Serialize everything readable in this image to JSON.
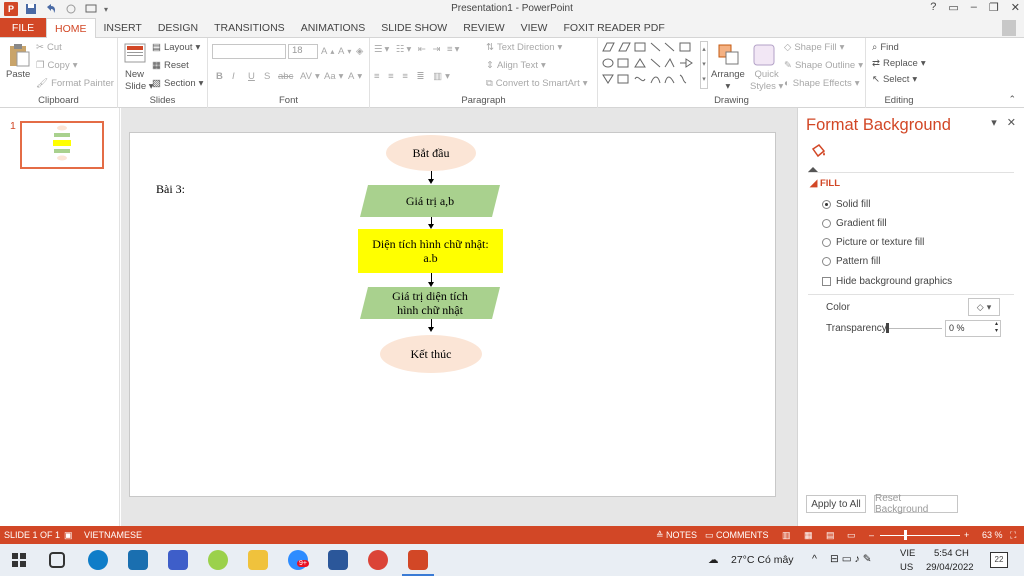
{
  "window": {
    "title": "Presentation1 - PowerPoint",
    "controls": [
      "?",
      "▭",
      "–",
      "❐",
      "✕"
    ]
  },
  "tabs": [
    "FILE",
    "HOME",
    "INSERT",
    "DESIGN",
    "TRANSITIONS",
    "ANIMATIONS",
    "SLIDE SHOW",
    "REVIEW",
    "VIEW",
    "FOXIT READER PDF"
  ],
  "ribbon": {
    "clipboard": {
      "label": "Clipboard",
      "paste": "Paste",
      "cut": "Cut",
      "copy": "Copy",
      "format_painter": "Format Painter"
    },
    "slides": {
      "label": "Slides",
      "new_slide_1": "New",
      "new_slide_2": "Slide",
      "layout": "Layout",
      "reset": "Reset",
      "section": "Section"
    },
    "font": {
      "label": "Font",
      "font_size": "18",
      "bold": "B",
      "italic": "I",
      "underline": "U",
      "strike": "S",
      "abc": "abc",
      "spacing": "AV",
      "case": "Aa",
      "color": "A"
    },
    "paragraph": {
      "label": "Paragraph",
      "text_direction": "Text Direction",
      "align_text": "Align Text",
      "smartart": "Convert to SmartArt"
    },
    "drawing": {
      "label": "Drawing",
      "arrange": "Arrange",
      "quick_styles_1": "Quick",
      "quick_styles_2": "Styles",
      "shape_fill": "Shape Fill",
      "shape_outline": "Shape Outline",
      "shape_effects": "Shape Effects"
    },
    "editing": {
      "label": "Editing",
      "find": "Find",
      "replace": "Replace",
      "select": "Select"
    }
  },
  "thumbnails": {
    "number": "1"
  },
  "slide": {
    "label": "Bài 3:",
    "start": "Bắt đầu",
    "input": "Giá trị a,b",
    "process_line1": "Diện tích hình chữ nhật:",
    "process_line2": "a.b",
    "output_line1": "Giá trị diện tích",
    "output_line2": "hình chữ nhật",
    "end": "Kết thúc"
  },
  "format_background": {
    "title": "Format Background",
    "section": "FILL",
    "options": [
      "Solid fill",
      "Gradient fill",
      "Picture or texture fill",
      "Pattern fill"
    ],
    "selected": "Solid fill",
    "hide_graphics": "Hide background graphics",
    "color_label": "Color",
    "transparency_label": "Transparency",
    "transparency_value": "0 %",
    "apply_all": "Apply to All",
    "reset": "Reset Background"
  },
  "status": {
    "slide": "SLIDE 1 OF 1",
    "language": "VIETNAMESE",
    "notes": "NOTES",
    "comments": "COMMENTS",
    "zoom": "63 %",
    "zoom_value": 0.63
  },
  "taskbar": {
    "weather": "27°C  Có mây",
    "lang1": "VIE",
    "lang2": "US",
    "time": "5:54 CH",
    "date": "29/04/2022",
    "notif": "22",
    "badge": "9+"
  },
  "colors": {
    "accent": "#d24726",
    "oval_fill": "#fbe5d6",
    "para_fill": "#a9d18e",
    "process_fill": "#ffff00"
  }
}
